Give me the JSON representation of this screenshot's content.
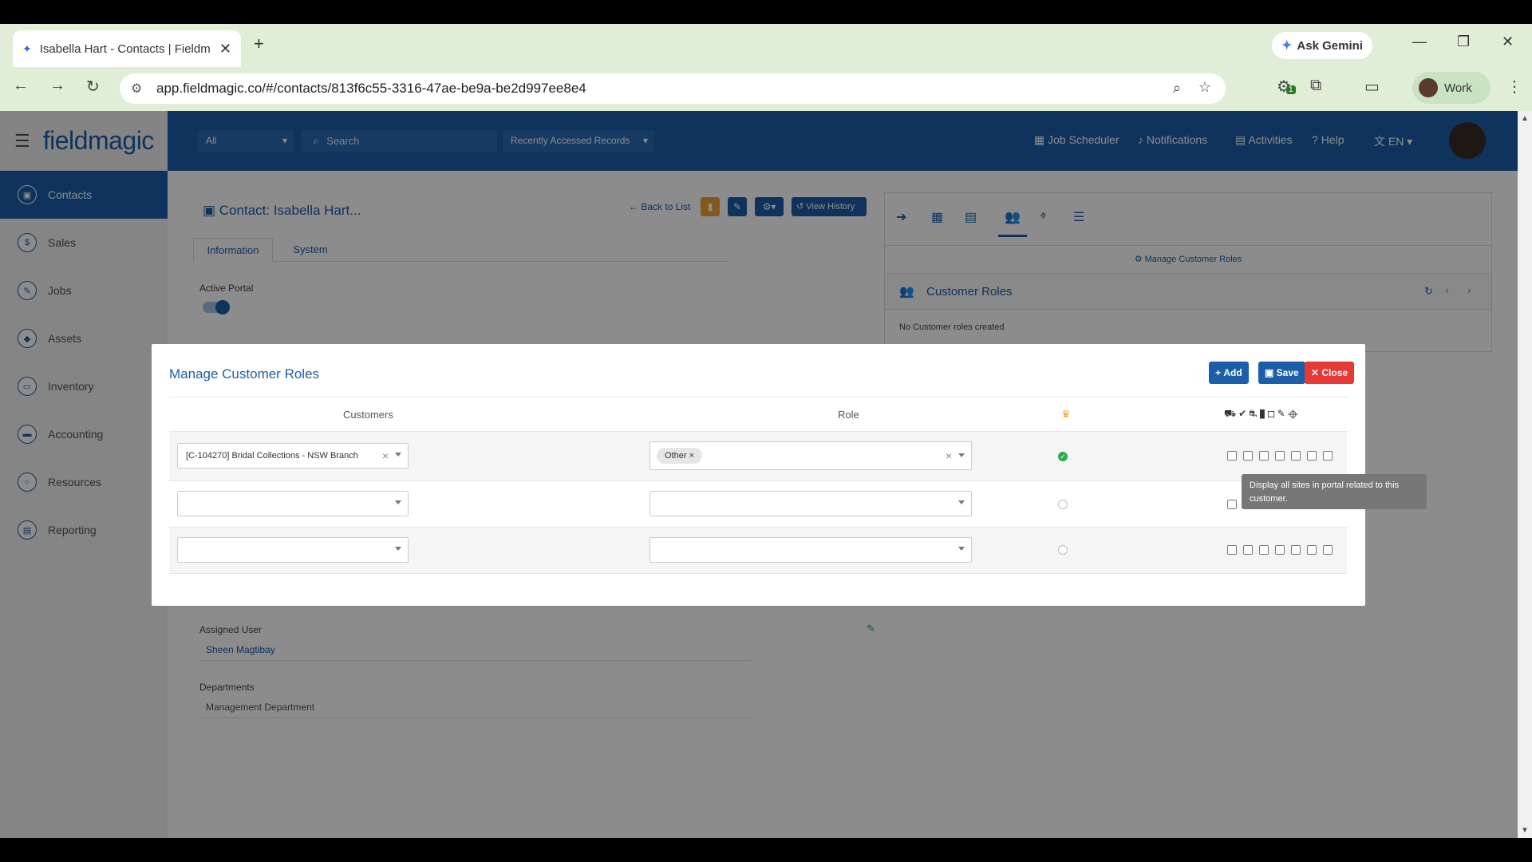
{
  "browser": {
    "tab_title": "Isabella Hart - Contacts | Fieldm",
    "ask_gemini": "Ask Gemini",
    "url": "app.fieldmagic.co/#/contacts/813f6c55-3316-47ae-be9a-be2d997ee8e4",
    "profile": "Work",
    "extension_badge": "1"
  },
  "app": {
    "logo": "fieldmagic",
    "filter_select": "All",
    "search_placeholder": "Search",
    "recent_select": "Recently Accessed Records",
    "nav": {
      "job_scheduler": "Job Scheduler",
      "notifications": "Notifications",
      "activities": "Activities",
      "help": "Help",
      "language": "EN"
    }
  },
  "sidebar": {
    "items": [
      {
        "label": "Contacts",
        "icon": "contact-card-icon"
      },
      {
        "label": "Sales",
        "icon": "dollar-icon"
      },
      {
        "label": "Jobs",
        "icon": "wrench-icon"
      },
      {
        "label": "Assets",
        "icon": "assets-icon"
      },
      {
        "label": "Inventory",
        "icon": "box-icon"
      },
      {
        "label": "Accounting",
        "icon": "card-icon"
      },
      {
        "label": "Resources",
        "icon": "network-icon"
      },
      {
        "label": "Reporting",
        "icon": "report-icon"
      }
    ]
  },
  "record": {
    "title": "Contact: Isabella Hart...",
    "back_to_list": "Back to List",
    "view_history": "View History",
    "tabs": [
      "Information",
      "System"
    ],
    "active_portal_label": "Active Portal",
    "assigned_user_label": "Assigned User",
    "assigned_user_value": "Sheen Magtibay",
    "departments_label": "Departments",
    "departments_value": "Management Department"
  },
  "right_panel": {
    "manage_link": "Manage Customer Roles",
    "section_title": "Customer Roles",
    "empty_text": "No Customer roles created"
  },
  "modal": {
    "title": "Manage Customer Roles",
    "add_label": "Add",
    "save_label": "Save",
    "close_label": "Close",
    "col_customers": "Customers",
    "col_role": "Role",
    "rows": [
      {
        "customer": "[C-104270] Bridal Collections - NSW Branch",
        "role_tag": "Other",
        "primary": true
      },
      {
        "customer": "",
        "role_tag": "",
        "primary": false
      },
      {
        "customer": "",
        "role_tag": "",
        "primary": false
      }
    ],
    "tooltip": "Display all sites in portal related to this customer."
  },
  "colors": {
    "brand_blue": "#1d5ea8",
    "add_blue": "#1d5ea8",
    "close_red": "#e53935",
    "delete_orange": "#f0a030",
    "success_green": "#2eaa4f"
  }
}
